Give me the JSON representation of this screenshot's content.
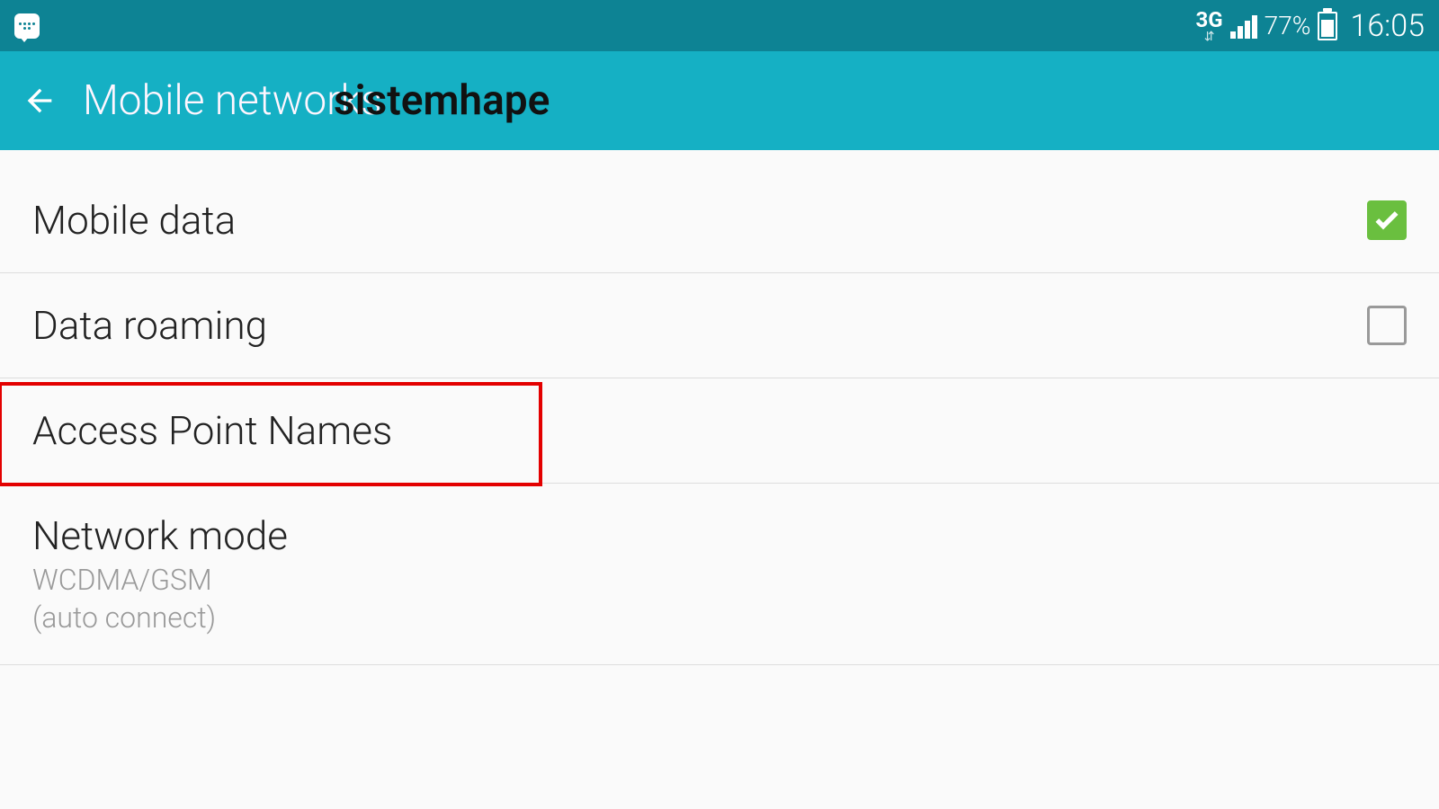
{
  "statusBar": {
    "networkType": "3G",
    "batteryPercent": "77%",
    "time": "16:05"
  },
  "appBar": {
    "title": "Mobile networks",
    "watermark": "sistemhape"
  },
  "items": {
    "mobileData": {
      "label": "Mobile data"
    },
    "dataRoaming": {
      "label": "Data roaming"
    },
    "apn": {
      "label": "Access Point Names"
    },
    "networkMode": {
      "label": "Network mode",
      "sub1": "WCDMA/GSM",
      "sub2": "(auto connect)"
    }
  }
}
